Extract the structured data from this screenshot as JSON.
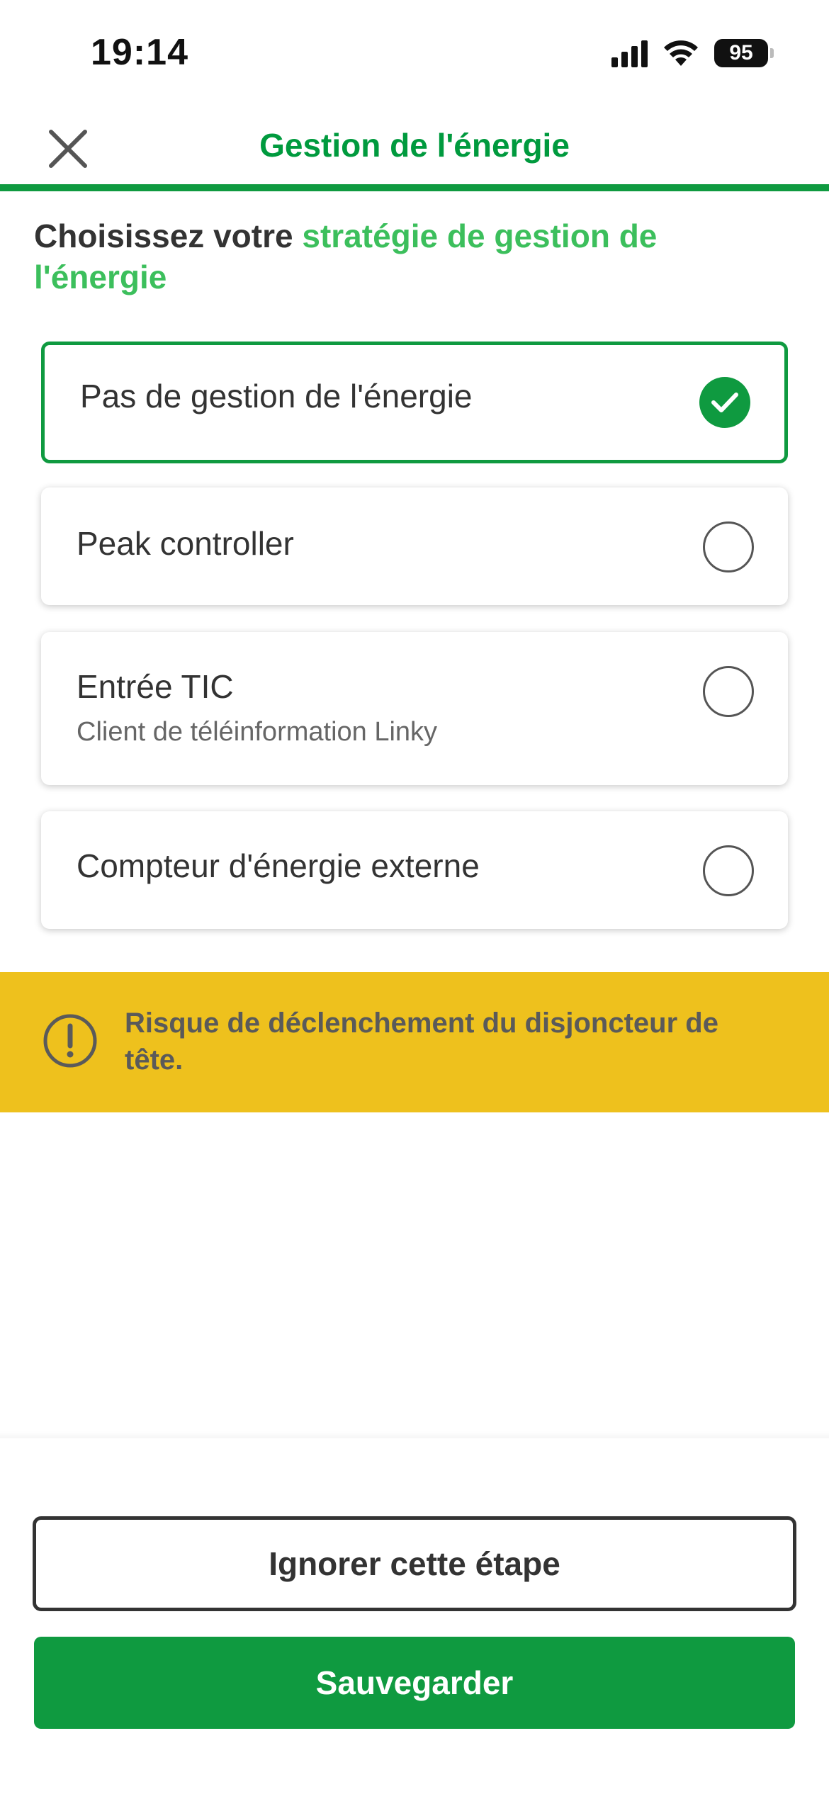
{
  "status_bar": {
    "time": "19:14",
    "battery": "95",
    "icons": [
      "cellular-signal-icon",
      "wifi-icon",
      "battery-icon"
    ]
  },
  "header": {
    "title": "Gestion de l'énergie",
    "close_icon": "close-icon"
  },
  "heading": {
    "prefix": "Choisissez votre ",
    "highlight": "stratégie de gestion de l'énergie"
  },
  "options": [
    {
      "label": "Pas de gestion de l'énergie",
      "subtitle": "",
      "selected": true
    },
    {
      "label": "Peak controller",
      "subtitle": "",
      "selected": false
    },
    {
      "label": "Entrée TIC",
      "subtitle": "Client de téléinformation Linky",
      "selected": false
    },
    {
      "label": "Compteur d'énergie externe",
      "subtitle": "",
      "selected": false
    }
  ],
  "warning": {
    "icon": "exclamation-circle-icon",
    "text": "Risque de déclenchement du disjoncteur de tête."
  },
  "actions": {
    "skip_label": "Ignorer cette étape",
    "save_label": "Sauvegarder"
  },
  "colors": {
    "primary": "#0f9a40",
    "accent_text": "#3cbf5c",
    "warning_bg": "#eec11d",
    "text": "#333333"
  }
}
